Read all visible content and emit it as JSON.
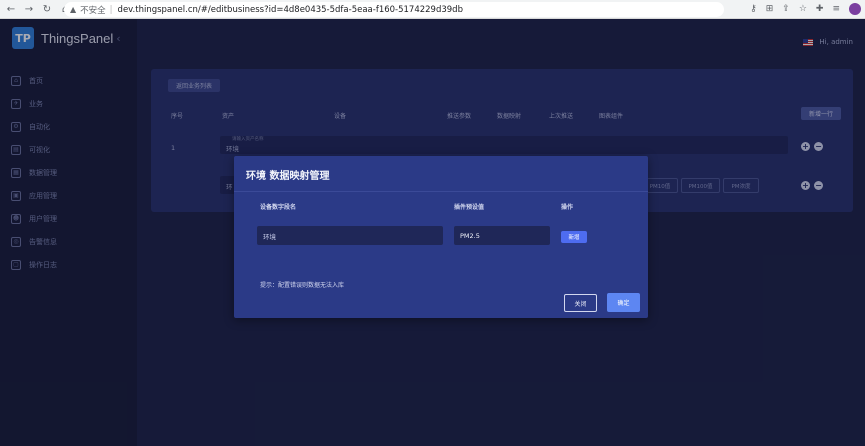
{
  "browser": {
    "nav_back": "←",
    "nav_forward": "→",
    "nav_reload": "↻",
    "home": "⌂",
    "security_warning": "▲",
    "insecure_label": "不安全",
    "separator": "|",
    "url": "dev.thingspanel.cn/#/editbusiness?id=4d8e0435-5dfa-5eaa-f160-5174229d39db",
    "icons": [
      "key-icon",
      "translate-icon",
      "share-icon",
      "star-icon",
      "extensions-icon",
      "reading-list-icon",
      "profile-icon"
    ]
  },
  "app": {
    "name": "ThingsPanel",
    "logo_mark": "TP",
    "collapse": "‹"
  },
  "sidebar": {
    "items": [
      {
        "label": "首页",
        "icon": "home-icon",
        "glyph": "⌂"
      },
      {
        "label": "业务",
        "icon": "business-icon",
        "glyph": "✈"
      },
      {
        "label": "自动化",
        "icon": "automation-icon",
        "glyph": "⚙"
      },
      {
        "label": "可视化",
        "icon": "visualization-icon",
        "glyph": "▤"
      },
      {
        "label": "数据管理",
        "icon": "data-icon",
        "glyph": "▦"
      },
      {
        "label": "应用管理",
        "icon": "app-icon",
        "glyph": "▣"
      },
      {
        "label": "用户管理",
        "icon": "user-icon",
        "glyph": "☻"
      },
      {
        "label": "告警信息",
        "icon": "alarm-icon",
        "glyph": "◎"
      },
      {
        "label": "操作日志",
        "icon": "log-icon",
        "glyph": "▢"
      }
    ]
  },
  "header": {
    "greeting": "Hi, admin"
  },
  "card": {
    "back_label": "返回业务列表",
    "add_row_label": "新增一行",
    "columns": [
      "序号",
      "资产",
      "设备",
      "推送参数",
      "数据映射",
      "上次推送",
      "图表组件"
    ],
    "rows": [
      {
        "index": "1",
        "asset_placeholder": "请输入资产名称",
        "asset_value": "环境"
      }
    ],
    "row2_prefix": "环",
    "tags": [
      "PM10值",
      "PM100值",
      "PM浓度"
    ],
    "plus": "+",
    "minus": "−"
  },
  "modal": {
    "title": "环境 数据映射管理",
    "col_field": "设备数字段名",
    "col_preset": "插件预设值",
    "col_action": "操作",
    "field_value": "环境",
    "preset_value": "PM2.5",
    "add_label": "新增",
    "tip": "提示：配置错误则数据无法入库",
    "close_label": "关闭",
    "ok_label": "确定"
  },
  "colors": {
    "background": "#1c2144",
    "sidebar": "#171b36",
    "card": "#27306a",
    "modal": "#2b3a87",
    "primary": "#5d86f2",
    "logo": "#2f7fd8"
  }
}
